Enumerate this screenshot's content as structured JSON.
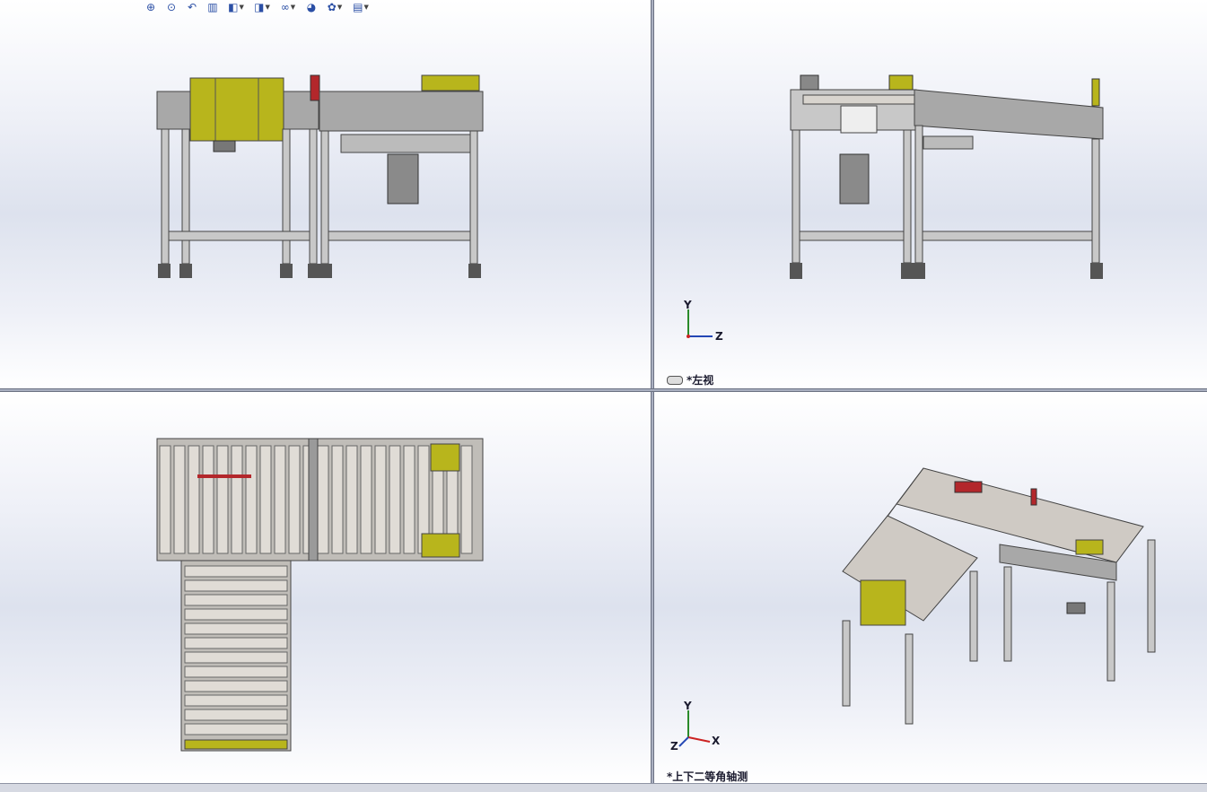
{
  "toolbar": {
    "buttons": [
      {
        "name": "zoom-to-fit-icon",
        "glyph": "🔍"
      },
      {
        "name": "zoom-to-area-icon",
        "glyph": "🔎"
      },
      {
        "name": "previous-view-icon",
        "glyph": "↶"
      },
      {
        "name": "section-view-icon",
        "glyph": "▥"
      },
      {
        "name": "view-orientation-icon",
        "glyph": "◧"
      },
      {
        "name": "display-style-icon",
        "glyph": "◨"
      },
      {
        "name": "hide-show-items-icon",
        "glyph": "∞"
      },
      {
        "name": "edit-appearance-icon",
        "glyph": "◕"
      },
      {
        "name": "apply-scene-icon",
        "glyph": "✿"
      },
      {
        "name": "view-settings-icon",
        "glyph": "▤"
      }
    ]
  },
  "viewports": {
    "left": {
      "label": "*左视"
    },
    "iso": {
      "label": "*上下二等角轴测"
    }
  },
  "axes": {
    "left": {
      "y": "Y",
      "z": "Z"
    },
    "iso": {
      "y": "Y",
      "x": "X",
      "z": "Z"
    }
  },
  "colors": {
    "frame": "#bfbfbf",
    "panel": "#b8b51c",
    "roller": "#d8d4ce",
    "red": "#b3272b"
  }
}
